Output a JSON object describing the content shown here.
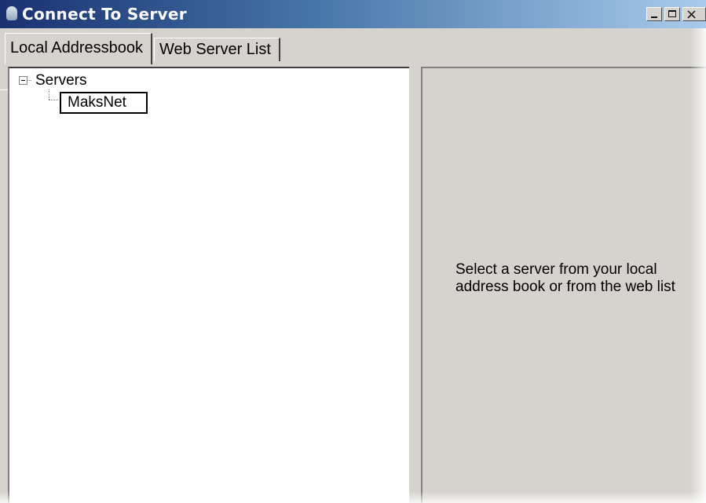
{
  "window": {
    "title": "Connect To Server",
    "controls": {
      "minimize": "_",
      "maximize": "",
      "close": "×"
    }
  },
  "tabs": [
    {
      "label": "Local Addressbook",
      "active": true
    },
    {
      "label": "Web Server List",
      "active": false
    }
  ],
  "tree": {
    "root": {
      "label": "Servers",
      "expander": "minus",
      "expanded": true
    },
    "children": [
      {
        "label": "MaksNet",
        "selected": true
      }
    ]
  },
  "detail": {
    "message_line1": "Select a server from your local",
    "message_line2": "address book or from the web list"
  },
  "icons": {
    "app": "app-icon",
    "minimize": "minimize-icon",
    "maximize": "maximize-icon",
    "close": "close-icon",
    "expander": "minus-box-icon"
  },
  "colors": {
    "titlebar_start": "#0a246a",
    "titlebar_end": "#a6caf0",
    "panel_gray": "#d6d3ce",
    "tree_background": "#ffffff"
  }
}
